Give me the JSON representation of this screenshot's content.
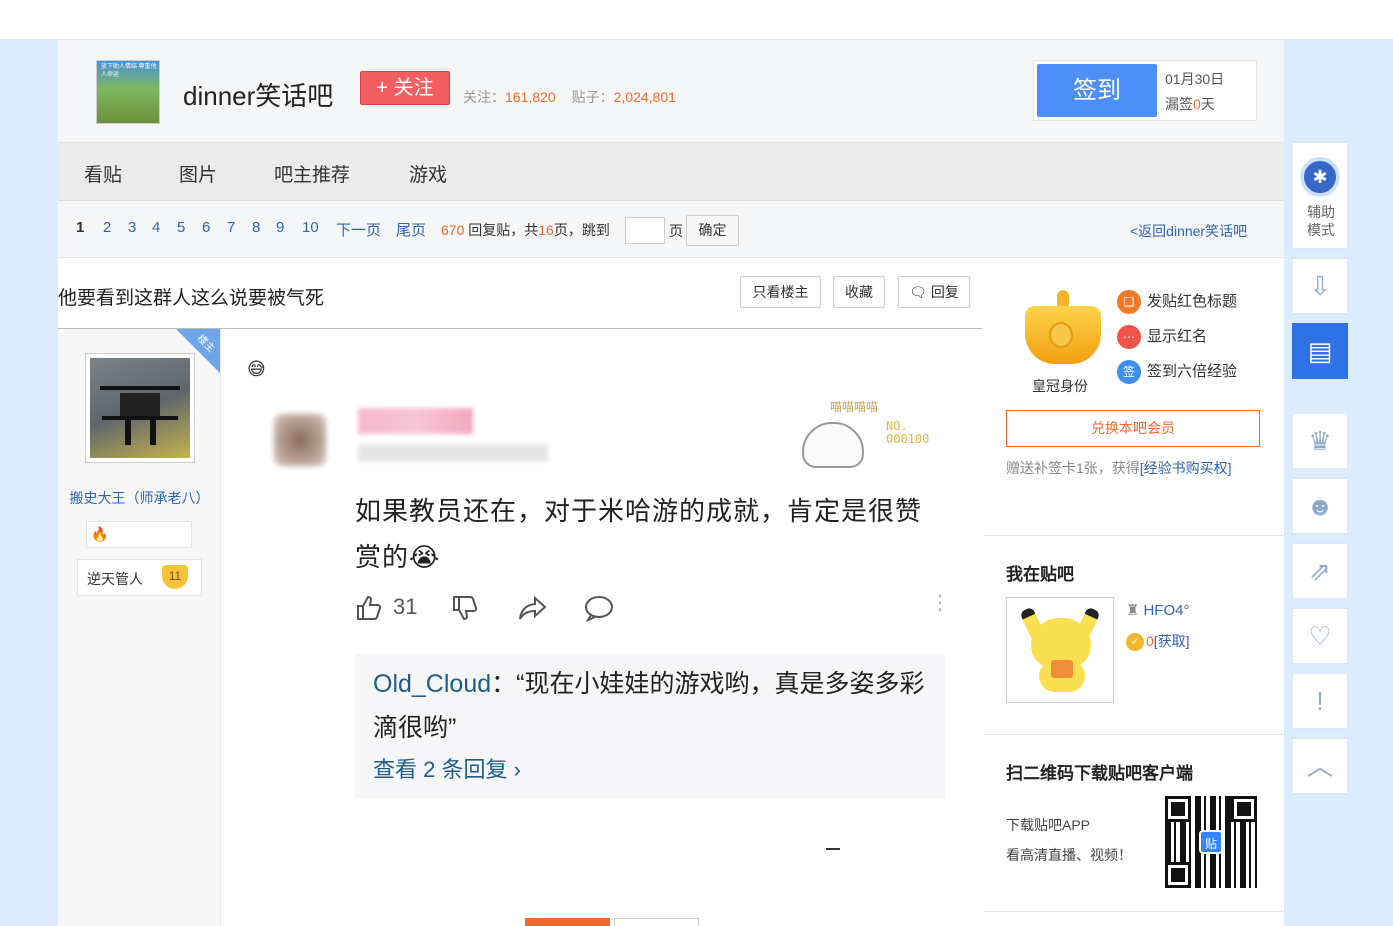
{
  "forum": {
    "name": "dinner笑话吧",
    "avatar_caption": "放下助人情结 尊重他人命运",
    "follow_label": "+ 关注",
    "followers_label": "关注：",
    "followers": "161,820",
    "posts_label": "贴子：",
    "posts": "2,024,801"
  },
  "signin": {
    "button": "签到",
    "date": "01月30日",
    "miss_prefix": "漏签",
    "miss_count": "0",
    "miss_suffix": "天"
  },
  "nav": [
    "看贴",
    "图片",
    "吧主推荐",
    "游戏"
  ],
  "pager": {
    "pages": [
      "1",
      "2",
      "3",
      "4",
      "5",
      "6",
      "7",
      "8",
      "9",
      "10"
    ],
    "current": "1",
    "next": "下一页",
    "last": "尾页",
    "reply_count": "670",
    "reply_label": "回复贴，共",
    "page_total": "16",
    "page_label": "页，跳到",
    "unit": "页",
    "confirm": "确定",
    "back": "<返回dinner笑话吧"
  },
  "post": {
    "title": "他要看到这群人这么说要被气死",
    "only_op": "只看楼主",
    "favorite": "收藏",
    "reply": "回复",
    "op_tag": "楼主",
    "emoji": "😅",
    "author": {
      "name": "搬史大王（师承老八）",
      "level_title": "逆天管人",
      "level": "11"
    },
    "screenshot": {
      "text": "如果教员还在，对于米哈游的成就，肯定是很赞赏的",
      "cry_emoji": "😭",
      "likes": "31",
      "deco_text": "喵喵喵喵",
      "deco_no": "NO. 000100",
      "reply_user": "Old_Cloud",
      "reply_text": "：“现在小娃娃的游戏哟，真是多姿多彩滴很哟”",
      "reply_more": "查看 2 条回复 ›"
    }
  },
  "sidebar": {
    "crown_label": "皇冠身份",
    "perks": [
      "发贴红色标题",
      "显示红名",
      "签到六倍经验"
    ],
    "perk_icon_text": "签",
    "exchange": "兑换本吧会员",
    "gift_text": "赠送补签卡1张，获得",
    "gift_link": "[经验书购买权]",
    "my_forum_title": "我在贴吧",
    "my_level": "HFO4°",
    "my_exp_value": "0",
    "my_exp_link": "[获取]",
    "qr_title": "扫二维码下载贴吧客户端",
    "download_line1": "下载贴吧APP",
    "download_line2": "看高清直播、视频！",
    "qr_logo": "贴"
  },
  "rail": {
    "assist_label": "辅助模式"
  },
  "colors": {
    "accent_blue": "#4e8ef7",
    "follow_red": "#f35e61",
    "orange": "#f06a2b",
    "link_blue": "#2d64b3"
  }
}
